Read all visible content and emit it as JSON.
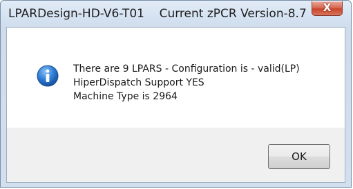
{
  "dialog": {
    "title": "LPARDesign-HD-V6-T01    Current zPCR Version-8.7",
    "close_label": "X",
    "icon": "info-icon",
    "message_lines": [
      "There are 9 LPARS - Configuration is - valid(LP)",
      "HiperDispatch Support YES",
      "Machine Type is 2964"
    ],
    "ok_label": "OK"
  },
  "colors": {
    "title_bar": "#d6e3f2",
    "close_button": "#c8452c",
    "info_icon": "#1c63c4",
    "button_area": "#f0f0f0"
  }
}
